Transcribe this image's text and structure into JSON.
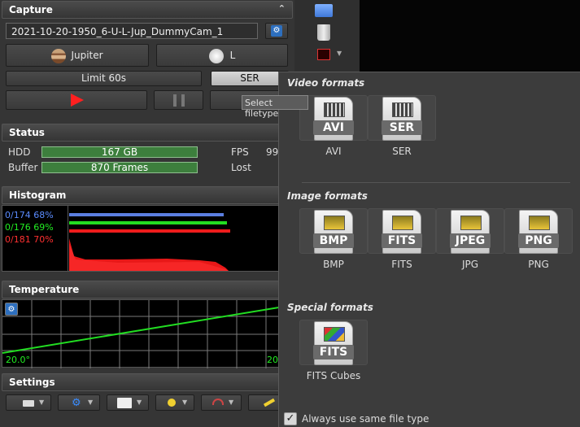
{
  "capture": {
    "title": "Capture",
    "filename": "2021-10-20-1950_6-U-L-Jup_DummyCam_1",
    "target_label": "Jupiter",
    "filter_label": "L",
    "limit_label": "Limit 60s",
    "filetype_label": "SER"
  },
  "tooltip": {
    "text": "Select filetype"
  },
  "status": {
    "title": "Status",
    "hdd_label": "HDD",
    "hdd_value": "167 GB",
    "buffer_label": "Buffer",
    "buffer_value": "870 Frames",
    "fps_label": "FPS",
    "fps_value": "99",
    "lost_label": "Lost"
  },
  "histogram": {
    "title": "Histogram",
    "rows": [
      {
        "text": "0/174 68%",
        "color": "#5b8cff"
      },
      {
        "text": "0/176 69%",
        "color": "#22ee22"
      },
      {
        "text": "0/181 70%",
        "color": "#ff3030"
      }
    ]
  },
  "temperature": {
    "title": "Temperature",
    "left_value": "20.0°",
    "right_value": "20"
  },
  "settings": {
    "title": "Settings"
  },
  "popup": {
    "video_title": "Video formats",
    "image_title": "Image formats",
    "special_title": "Special formats",
    "video": [
      {
        "tag": "AVI",
        "name": "AVI"
      },
      {
        "tag": "SER",
        "name": "SER"
      }
    ],
    "image": [
      {
        "tag": "BMP",
        "name": "BMP"
      },
      {
        "tag": "FITS",
        "name": "FITS"
      },
      {
        "tag": "JPEG",
        "name": "JPG"
      },
      {
        "tag": "PNG",
        "name": "PNG"
      }
    ],
    "special": [
      {
        "tag": "FITS",
        "name": "FITS Cubes"
      }
    ],
    "always_same_label": "Always use same file type",
    "always_same_checked": true
  },
  "colors": {
    "accent_green": "#3d7f3d",
    "record_red": "#ff2020"
  }
}
